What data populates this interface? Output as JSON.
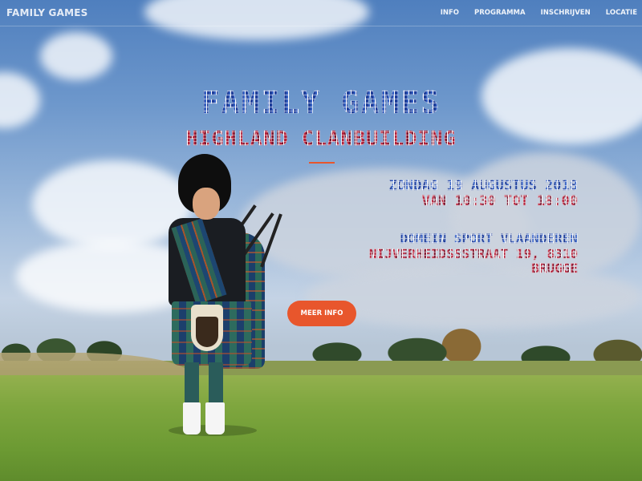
{
  "navbar": {
    "brand": "FAMILY GAMES",
    "links": [
      "INFO",
      "PROGRAMMA",
      "INSCHRIJVEN",
      "LOCATIE"
    ]
  },
  "hero": {
    "title": "FAMILY GAMES",
    "subtitle": "HIGHLAND CLANBUILDING",
    "date": "ZONDAG 19 AUGUSTUS 2018",
    "time": "VAN 10:30 TOT 18:00",
    "venue": "DOMEIN SPORT VLAANDEREN",
    "street": "NIJVERHEIDSSSTRAAT 19, 8310",
    "city": "BRUGGE",
    "cta_label": "MEER INFO"
  },
  "colors": {
    "accent": "#e8562c",
    "title_blue": "#1f3f9a",
    "title_red": "#b3213a"
  }
}
